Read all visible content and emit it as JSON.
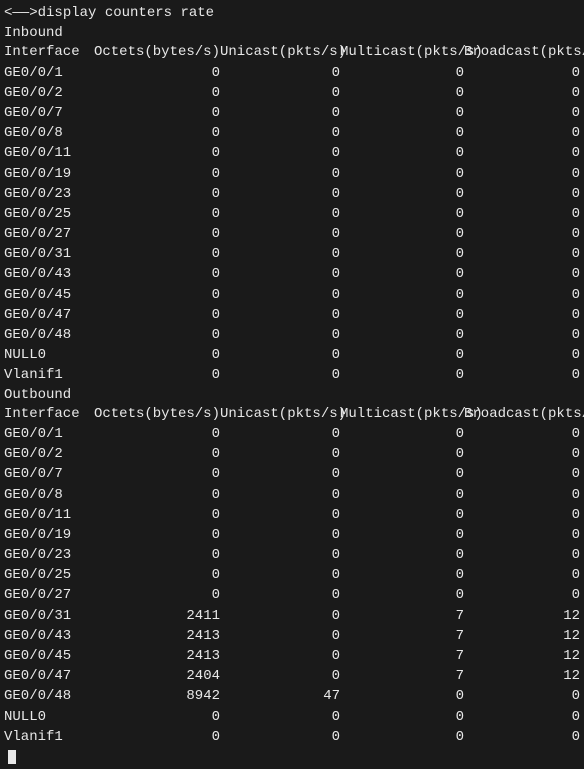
{
  "prompt": {
    "prefix": "<",
    "masked": "——",
    "suffix": ">display counters rate"
  },
  "headers": {
    "iface": "Interface",
    "octets": "Octets(bytes/s)",
    "unicast": "Unicast(pkts/s)",
    "multicast": "Multicast(pkts/s)",
    "broadcast": "Broadcast(pkts/s)"
  },
  "sections": {
    "inbound": {
      "label": "Inbound",
      "rows": [
        {
          "iface": "GE0/0/1",
          "oct": "0",
          "uni": "0",
          "multi": "0",
          "broad": "0"
        },
        {
          "iface": "GE0/0/2",
          "oct": "0",
          "uni": "0",
          "multi": "0",
          "broad": "0"
        },
        {
          "iface": "GE0/0/7",
          "oct": "0",
          "uni": "0",
          "multi": "0",
          "broad": "0"
        },
        {
          "iface": "GE0/0/8",
          "oct": "0",
          "uni": "0",
          "multi": "0",
          "broad": "0"
        },
        {
          "iface": "GE0/0/11",
          "oct": "0",
          "uni": "0",
          "multi": "0",
          "broad": "0"
        },
        {
          "iface": "GE0/0/19",
          "oct": "0",
          "uni": "0",
          "multi": "0",
          "broad": "0"
        },
        {
          "iface": "GE0/0/23",
          "oct": "0",
          "uni": "0",
          "multi": "0",
          "broad": "0"
        },
        {
          "iface": "GE0/0/25",
          "oct": "0",
          "uni": "0",
          "multi": "0",
          "broad": "0"
        },
        {
          "iface": "GE0/0/27",
          "oct": "0",
          "uni": "0",
          "multi": "0",
          "broad": "0"
        },
        {
          "iface": "GE0/0/31",
          "oct": "0",
          "uni": "0",
          "multi": "0",
          "broad": "0"
        },
        {
          "iface": "GE0/0/43",
          "oct": "0",
          "uni": "0",
          "multi": "0",
          "broad": "0"
        },
        {
          "iface": "GE0/0/45",
          "oct": "0",
          "uni": "0",
          "multi": "0",
          "broad": "0"
        },
        {
          "iface": "GE0/0/47",
          "oct": "0",
          "uni": "0",
          "multi": "0",
          "broad": "0"
        },
        {
          "iface": "GE0/0/48",
          "oct": "0",
          "uni": "0",
          "multi": "0",
          "broad": "0"
        },
        {
          "iface": "NULL0",
          "oct": "0",
          "uni": "0",
          "multi": "0",
          "broad": "0"
        },
        {
          "iface": "Vlanif1",
          "oct": "0",
          "uni": "0",
          "multi": "0",
          "broad": "0"
        }
      ]
    },
    "outbound": {
      "label": "Outbound",
      "rows": [
        {
          "iface": "GE0/0/1",
          "oct": "0",
          "uni": "0",
          "multi": "0",
          "broad": "0"
        },
        {
          "iface": "GE0/0/2",
          "oct": "0",
          "uni": "0",
          "multi": "0",
          "broad": "0"
        },
        {
          "iface": "GE0/0/7",
          "oct": "0",
          "uni": "0",
          "multi": "0",
          "broad": "0"
        },
        {
          "iface": "GE0/0/8",
          "oct": "0",
          "uni": "0",
          "multi": "0",
          "broad": "0"
        },
        {
          "iface": "GE0/0/11",
          "oct": "0",
          "uni": "0",
          "multi": "0",
          "broad": "0"
        },
        {
          "iface": "GE0/0/19",
          "oct": "0",
          "uni": "0",
          "multi": "0",
          "broad": "0"
        },
        {
          "iface": "GE0/0/23",
          "oct": "0",
          "uni": "0",
          "multi": "0",
          "broad": "0"
        },
        {
          "iface": "GE0/0/25",
          "oct": "0",
          "uni": "0",
          "multi": "0",
          "broad": "0"
        },
        {
          "iface": "GE0/0/27",
          "oct": "0",
          "uni": "0",
          "multi": "0",
          "broad": "0"
        },
        {
          "iface": "GE0/0/31",
          "oct": "2411",
          "uni": "0",
          "multi": "7",
          "broad": "12"
        },
        {
          "iface": "GE0/0/43",
          "oct": "2413",
          "uni": "0",
          "multi": "7",
          "broad": "12"
        },
        {
          "iface": "GE0/0/45",
          "oct": "2413",
          "uni": "0",
          "multi": "7",
          "broad": "12"
        },
        {
          "iface": "GE0/0/47",
          "oct": "2404",
          "uni": "0",
          "multi": "7",
          "broad": "12"
        },
        {
          "iface": "GE0/0/48",
          "oct": "8942",
          "uni": "47",
          "multi": "0",
          "broad": "0"
        },
        {
          "iface": "NULL0",
          "oct": "0",
          "uni": "0",
          "multi": "0",
          "broad": "0"
        },
        {
          "iface": "Vlanif1",
          "oct": "0",
          "uni": "0",
          "multi": "0",
          "broad": "0"
        }
      ]
    }
  }
}
